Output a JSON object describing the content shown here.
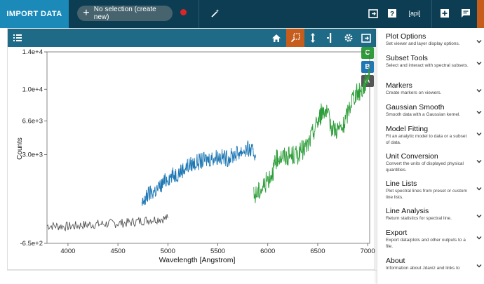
{
  "topbar": {
    "import_label": "IMPORT DATA",
    "selection_label": "No selection (create new)",
    "api_label": "[api]",
    "colors": {
      "bar": "#0c3d52",
      "import": "#1b8ab8",
      "record": "#d9262a"
    }
  },
  "viewer": {
    "toolbar_icons": [
      "layers-icon",
      "home-icon",
      "zoom-icon",
      "pan-vertical-icon",
      "pan-horizontal-icon",
      "settings-icon",
      "export-icon"
    ],
    "data_badges": [
      {
        "label": "C",
        "color": "#2e9e3a"
      },
      {
        "label": "B",
        "color": "#1f78b4"
      },
      {
        "label": "A",
        "color": "#555555"
      }
    ]
  },
  "chart_data": {
    "type": "line",
    "xlabel": "Wavelength [Angstrom]",
    "ylabel": "Counts",
    "xlim": [
      3790,
      7020
    ],
    "ylim": [
      -6500,
      14000
    ],
    "x_ticks": [
      "4000",
      "4500",
      "5000",
      "5500",
      "6000",
      "6500",
      "7000"
    ],
    "y_ticks": [
      "-6.5e+2",
      "3.0e+3",
      "6.6e+3",
      "1.0e+4",
      "1.4e+4"
    ],
    "series": [
      {
        "name": "A",
        "color": "#555555",
        "x": [
          3790,
          4000,
          4200,
          4400,
          4600,
          4800,
          5000
        ],
        "y": [
          -4600,
          -4700,
          -4500,
          -4400,
          -4300,
          -4000,
          -3800
        ]
      },
      {
        "name": "B",
        "color": "#1f78b4",
        "x": [
          4740,
          4800,
          4900,
          5000,
          5100,
          5200,
          5300,
          5400,
          5500,
          5600,
          5700,
          5800,
          5880
        ],
        "y": [
          -2500,
          -1300,
          -700,
          500,
          1000,
          1800,
          2200,
          2500,
          2800,
          2600,
          3200,
          3600,
          3000
        ]
      },
      {
        "name": "C",
        "color": "#2e9e3a",
        "x": [
          5860,
          5950,
          6050,
          6100,
          6200,
          6300,
          6400,
          6500,
          6560,
          6650,
          6750,
          6850,
          6950,
          7020
        ],
        "y": [
          -1500,
          -500,
          1200,
          2800,
          2800,
          3000,
          4000,
          6600,
          8000,
          5800,
          5700,
          9200,
          10000,
          12000
        ]
      }
    ]
  },
  "sidebar": {
    "plugins": [
      {
        "title": "Plot Options",
        "desc": "Set viewer and layer display options."
      },
      {
        "title": "Subset Tools",
        "desc": "Select and interact with spectral subsets."
      },
      {
        "title": "Markers",
        "desc": "Create markers on viewers."
      },
      {
        "title": "Gaussian Smooth",
        "desc": "Smooth data with a Gaussian kernel."
      },
      {
        "title": "Model Fitting",
        "desc": "Fit an analytic model to data or a subset of data."
      },
      {
        "title": "Unit Conversion",
        "desc": "Convert the units of displayed physical quantities."
      },
      {
        "title": "Line Lists",
        "desc": "Plot spectral lines from preset or custom line lists."
      },
      {
        "title": "Line Analysis",
        "desc": "Return statistics for spectral line."
      },
      {
        "title": "Export",
        "desc": "Export data/plots and other outputs to a file."
      },
      {
        "title": "About",
        "desc": "Information about Jdaviz and links to"
      }
    ]
  }
}
